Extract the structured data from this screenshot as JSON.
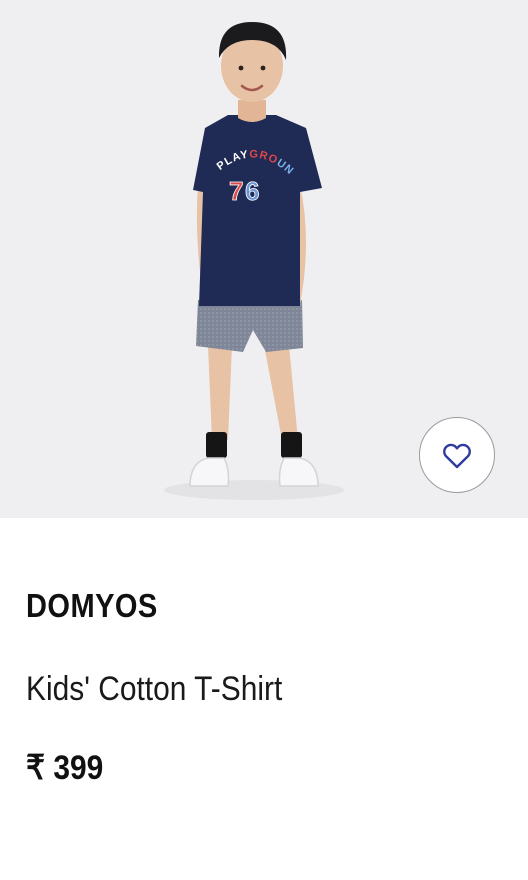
{
  "product": {
    "image_alt_icon": "product-photo",
    "wishlist_icon": "heart-icon",
    "brand": "DOMYOS",
    "name": "Kids' Cotton T-Shirt",
    "price": "₹ 399"
  },
  "colors": {
    "image_background": "#efeff1",
    "heart_stroke": "#2f3b9e",
    "text": "#111111"
  }
}
